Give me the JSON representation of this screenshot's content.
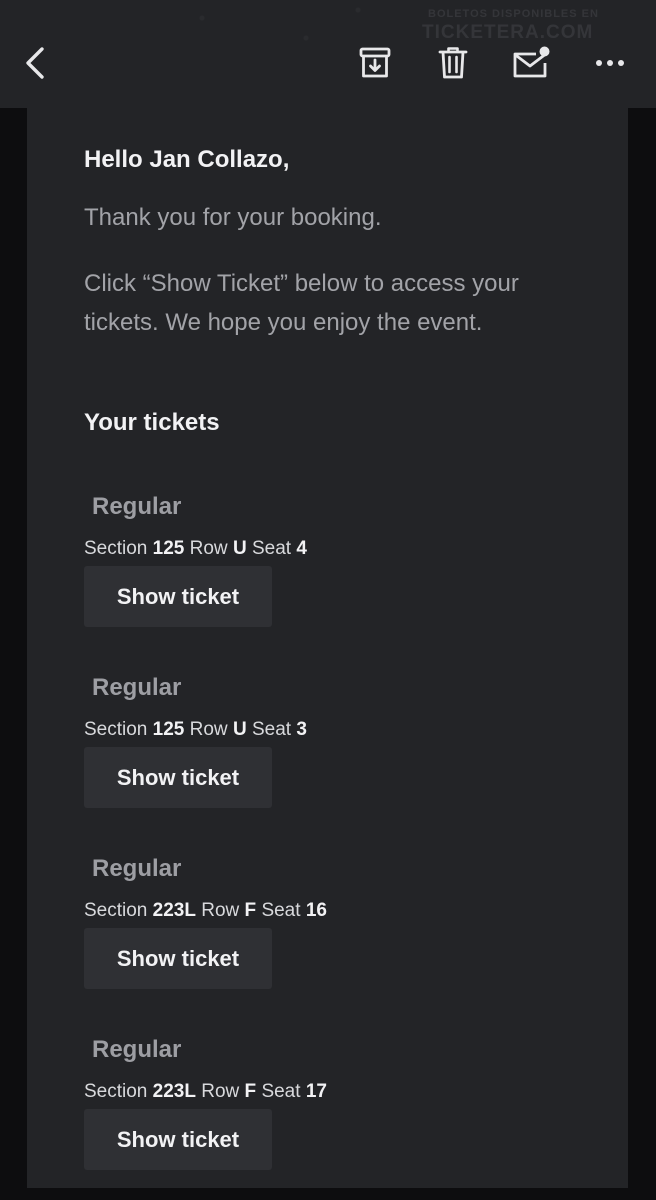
{
  "toolbar": {
    "back_icon": "chevron-left-icon",
    "archive_icon": "archive-download-icon",
    "delete_icon": "trash-icon",
    "mark_unread_icon": "mail-unread-icon",
    "more_icon": "more-horizontal-icon",
    "watermark_line1": "Boletos disponibles en",
    "watermark_line2": "TICKETERA.COM"
  },
  "email": {
    "greeting": "Hello Jan Collazo,",
    "thanks": "Thank you for your booking.",
    "instructions": "Click “Show Ticket” below to access your tickets. We hope you enjoy the event.",
    "tickets_heading": "Your tickets"
  },
  "labels": {
    "section": "Section",
    "row": "Row",
    "seat": "Seat"
  },
  "tickets": [
    {
      "type": "Regular",
      "section": "125",
      "row": "U",
      "seat": "4",
      "button": "Show ticket"
    },
    {
      "type": "Regular",
      "section": "125",
      "row": "U",
      "seat": "3",
      "button": "Show ticket"
    },
    {
      "type": "Regular",
      "section": "223L",
      "row": "F",
      "seat": "16",
      "button": "Show ticket"
    },
    {
      "type": "Regular",
      "section": "223L",
      "row": "F",
      "seat": "17",
      "button": "Show ticket"
    }
  ],
  "colors": {
    "background": "#0d0d0f",
    "panel": "#232427",
    "button": "#2f3034",
    "text_primary": "#f2f2f4",
    "text_muted": "#a2a3a8"
  }
}
